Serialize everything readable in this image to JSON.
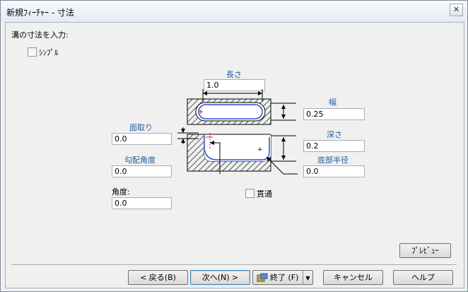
{
  "window": {
    "title": "新規ﾌｨｰﾁｬｰ - 寸法",
    "close_glyph": "✕"
  },
  "prompt": "溝の寸法を入力:",
  "simple": {
    "label": "ｼﾝﾌﾟﾙ"
  },
  "fields": {
    "length": {
      "label": "長さ",
      "value": "1.0"
    },
    "width": {
      "label": "幅",
      "value": "0.25"
    },
    "depth": {
      "label": "深さ",
      "value": "0.2"
    },
    "bottom_radius": {
      "label": "底部半径",
      "value": "0.0"
    },
    "chamfer": {
      "label": "面取り",
      "value": "0.0"
    },
    "draft_angle": {
      "label": "勾配角度",
      "value": "0.0"
    },
    "angle": {
      "label": "角度:",
      "value": "0.0"
    }
  },
  "through": {
    "label": "貫通"
  },
  "buttons": {
    "preview": "ﾌﾟﾚﾋﾞｭｰ",
    "back": "< 戻る(B)",
    "next": "次へ(N) >",
    "finish": "終了 (F)",
    "cancel": "キャンセル",
    "help": "ヘルプ"
  },
  "colors": {
    "label_blue": "#1f5c9f",
    "profile_blue": "#2a4fd0",
    "marker_red": "#d01818"
  }
}
